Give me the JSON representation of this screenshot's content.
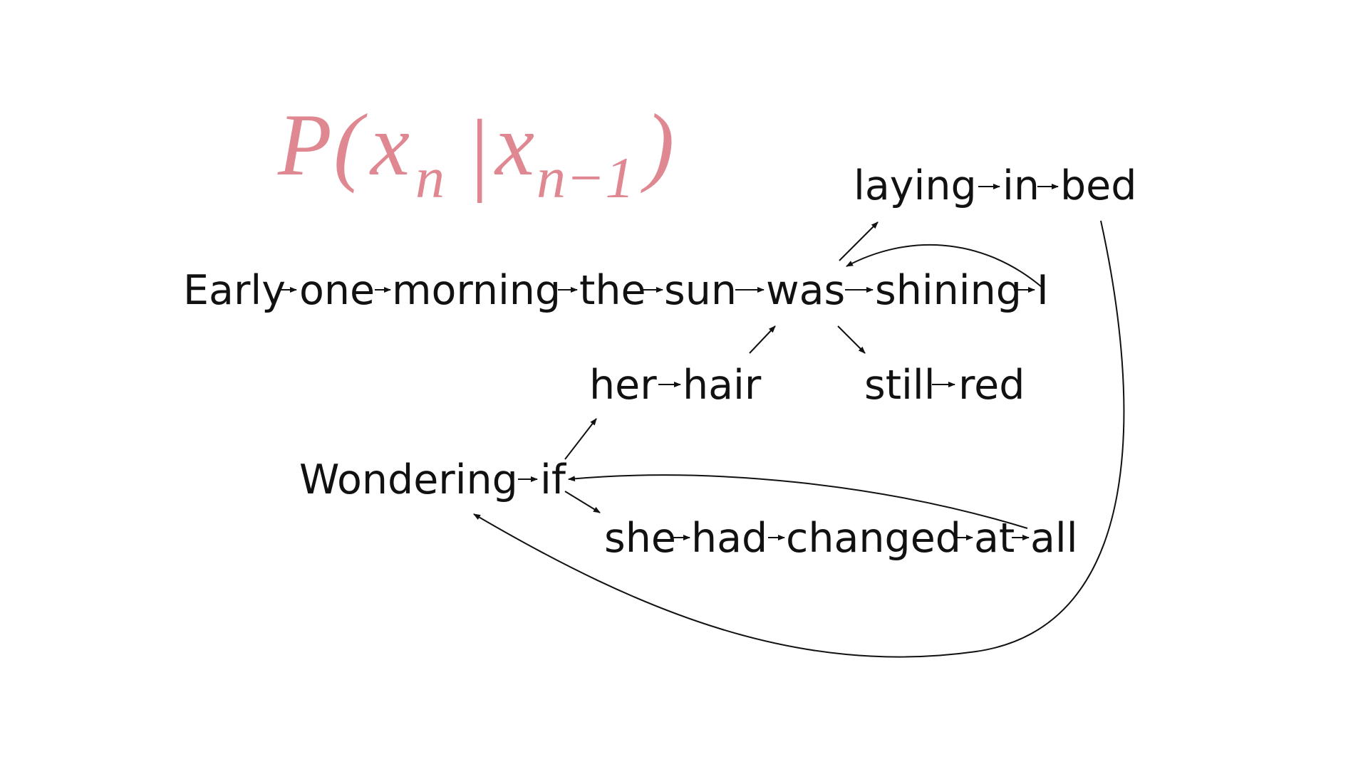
{
  "formula": {
    "symbol": "P",
    "open_paren": "(",
    "var": "x",
    "sub_n": "n",
    "bar": "|",
    "var2": "x",
    "sub_n_minus_1": "n−1",
    "close_paren": ")",
    "color": "#e08891"
  },
  "words": {
    "early": "Early",
    "one": "one",
    "morning": "morning",
    "the": "the",
    "sun": "sun",
    "was": "was",
    "shining": "shining",
    "i": "I",
    "laying": "laying",
    "in": "in",
    "bed": "bed",
    "her": "her",
    "hair": "hair",
    "still": "still",
    "red": "red",
    "wondering": "Wondering",
    "if": "if",
    "she": "she",
    "had": "had",
    "changed": "changed",
    "at": "at",
    "all": "all"
  }
}
